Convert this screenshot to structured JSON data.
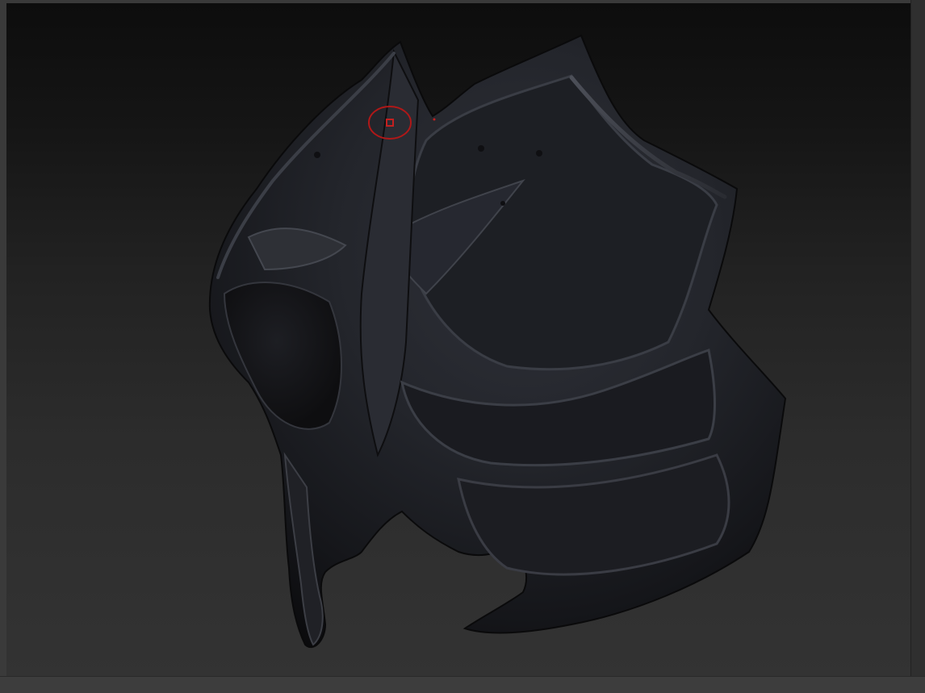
{
  "app": {
    "name": "",
    "document_title": ""
  },
  "viewport": {
    "background_top": "#0d0d0d",
    "background_bottom": "#333333",
    "model": {
      "name": "",
      "material_color": "#2a2b30",
      "highlight_color": "#4a4d56",
      "shadow_color": "#0c0c0e"
    },
    "brush_cursor": {
      "ring_color": "#b01818",
      "center_color": "#c42020"
    }
  },
  "colors": {
    "frame": "#3a3a3a",
    "panel": "#2f2f2f"
  }
}
